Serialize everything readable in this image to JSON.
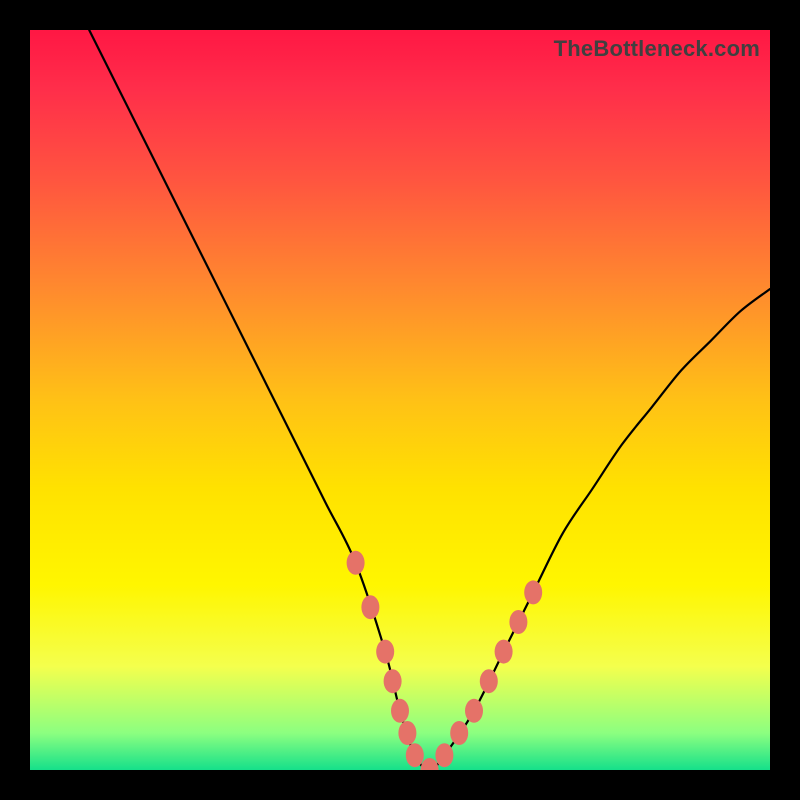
{
  "watermark": "TheBottleneck.com",
  "chart_data": {
    "type": "line",
    "title": "",
    "xlabel": "",
    "ylabel": "",
    "xlim": [
      0,
      100
    ],
    "ylim": [
      0,
      100
    ],
    "series": [
      {
        "name": "bottleneck-curve",
        "x": [
          8,
          12,
          16,
          20,
          24,
          28,
          32,
          36,
          40,
          44,
          48,
          50,
          52,
          54,
          56,
          60,
          64,
          68,
          72,
          76,
          80,
          84,
          88,
          92,
          96,
          100
        ],
        "values": [
          100,
          92,
          84,
          76,
          68,
          60,
          52,
          44,
          36,
          28,
          16,
          8,
          2,
          0,
          2,
          8,
          16,
          24,
          32,
          38,
          44,
          49,
          54,
          58,
          62,
          65
        ]
      }
    ],
    "markers": {
      "name": "salmon-dots",
      "x": [
        44,
        46,
        48,
        49,
        50,
        51,
        52,
        54,
        56,
        58,
        60,
        62,
        64,
        66,
        68
      ],
      "values": [
        28,
        22,
        16,
        12,
        8,
        5,
        2,
        0,
        2,
        5,
        8,
        12,
        16,
        20,
        24
      ],
      "color": "#e57268"
    },
    "background_gradient": {
      "stops": [
        {
          "pos": 0.0,
          "color": "#ff1744"
        },
        {
          "pos": 0.08,
          "color": "#ff2e4a"
        },
        {
          "pos": 0.2,
          "color": "#ff5440"
        },
        {
          "pos": 0.35,
          "color": "#ff8a2e"
        },
        {
          "pos": 0.5,
          "color": "#ffc116"
        },
        {
          "pos": 0.62,
          "color": "#ffe200"
        },
        {
          "pos": 0.75,
          "color": "#fff600"
        },
        {
          "pos": 0.86,
          "color": "#f4ff4d"
        },
        {
          "pos": 0.95,
          "color": "#8cff80"
        },
        {
          "pos": 1.0,
          "color": "#15e08a"
        }
      ]
    }
  }
}
